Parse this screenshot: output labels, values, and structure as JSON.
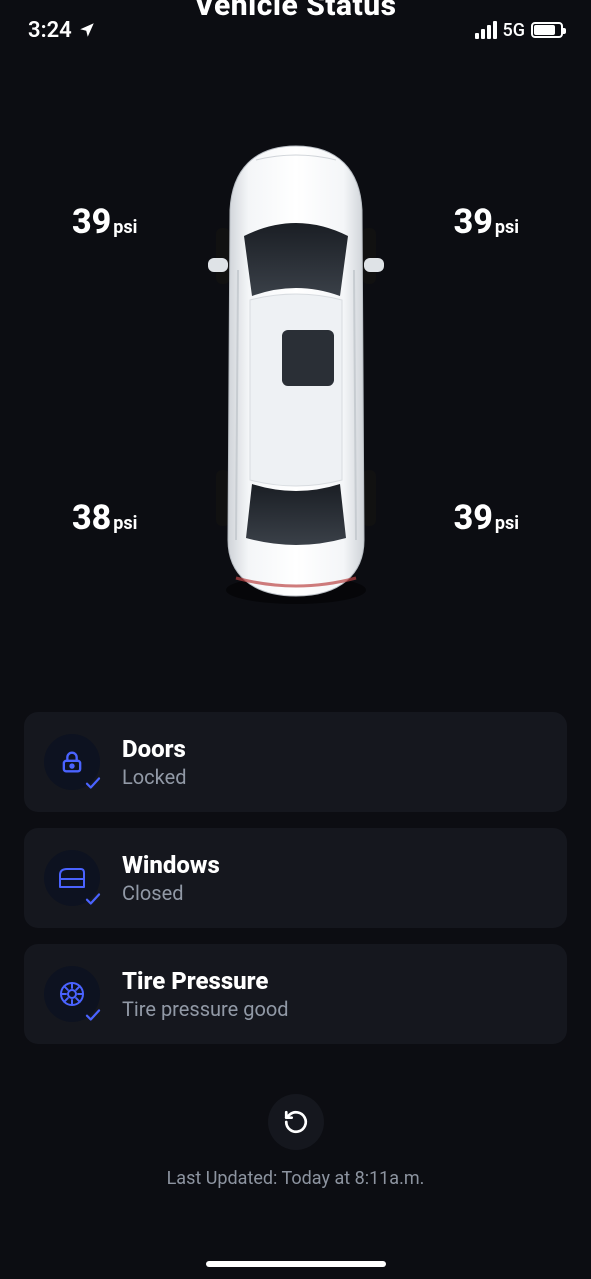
{
  "status_bar": {
    "time": "3:24",
    "network_label": "5G"
  },
  "page_title": "Vehicle Status",
  "tires": {
    "unit": "psi",
    "front_left": "39",
    "front_right": "39",
    "rear_left": "38",
    "rear_right": "39"
  },
  "status_items": [
    {
      "icon": "lock",
      "title": "Doors",
      "subtitle": "Locked"
    },
    {
      "icon": "window",
      "title": "Windows",
      "subtitle": "Closed"
    },
    {
      "icon": "tire",
      "title": "Tire Pressure",
      "subtitle": "Tire pressure good"
    }
  ],
  "last_updated": "Last Updated: Today at 8:11a.m."
}
